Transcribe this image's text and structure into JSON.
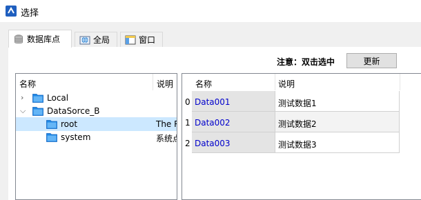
{
  "window": {
    "title": "选择"
  },
  "tabs": [
    {
      "label": "数据库点",
      "icon": "database-icon",
      "active": true
    },
    {
      "label": "全局",
      "icon": "globe-icon",
      "active": false
    },
    {
      "label": "窗口",
      "icon": "window-icon",
      "active": false
    }
  ],
  "toolbar": {
    "notice": "注意：双击选中",
    "update_label": "更新"
  },
  "tree": {
    "columns": [
      "名称",
      "说明"
    ],
    "nodes": [
      {
        "label": "Local",
        "expanded": false,
        "desc": ""
      },
      {
        "label": "DataSorce_B",
        "expanded": true,
        "desc": ""
      },
      {
        "label": "root",
        "desc": "The R",
        "selected": true
      },
      {
        "label": "system",
        "desc": "系统点"
      }
    ]
  },
  "grid": {
    "columns": [
      "名称",
      "说明"
    ],
    "rows": [
      {
        "index": "0",
        "name": "Data001",
        "desc": "测试数据1"
      },
      {
        "index": "1",
        "name": "Data002",
        "desc": "测试数据2"
      },
      {
        "index": "2",
        "name": "Data003",
        "desc": "测试数据3"
      }
    ]
  },
  "colors": {
    "accent_link": "#0000cc",
    "selection": "#cce8ff",
    "folder": "#1e88e5"
  }
}
